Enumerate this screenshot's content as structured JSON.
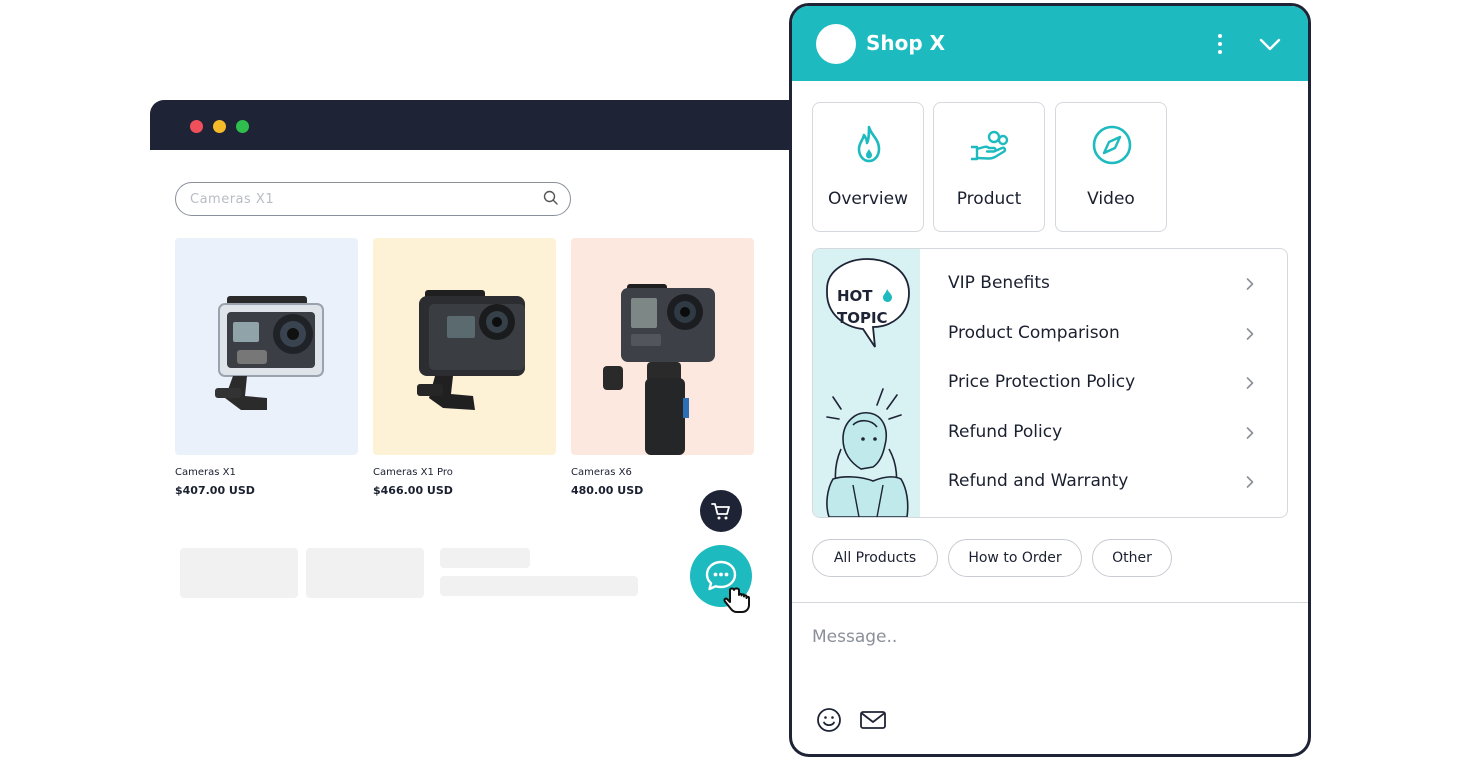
{
  "shop": {
    "search": {
      "value": "Cameras X1",
      "icon": "search-icon"
    },
    "products": [
      {
        "name": "Cameras X1",
        "price": "$407.00 USD",
        "bg": "#ebf1fb"
      },
      {
        "name": "Cameras X1 Pro",
        "price": "$466.00 USD",
        "bg": "#fdf1d6"
      },
      {
        "name": "Cameras X6",
        "price": "480.00 USD",
        "bg": "#fde8df"
      }
    ],
    "cart_icon": "cart-icon",
    "chat_launcher_icon": "chat-bubble-icon"
  },
  "chat": {
    "title": "Shop X",
    "header_color": "#1dbbbf",
    "tiles": [
      {
        "label": "Overview",
        "icon": "flame-icon"
      },
      {
        "label": "Product",
        "icon": "hand-coins-icon"
      },
      {
        "label": "Video",
        "icon": "compass-icon"
      }
    ],
    "banner": {
      "line1": "HOT",
      "line2": "TOPIC"
    },
    "topics": [
      {
        "label": "VIP Benefits"
      },
      {
        "label": "Product Comparison"
      },
      {
        "label": "Price Protection Policy"
      },
      {
        "label": "Refund Policy"
      },
      {
        "label": "Refund and Warranty"
      }
    ],
    "chips": [
      {
        "label": "All Products"
      },
      {
        "label": "How to Order"
      },
      {
        "label": "Other"
      }
    ],
    "message_placeholder": "Message..",
    "footer_icons": [
      "smile-icon",
      "mail-icon"
    ]
  }
}
